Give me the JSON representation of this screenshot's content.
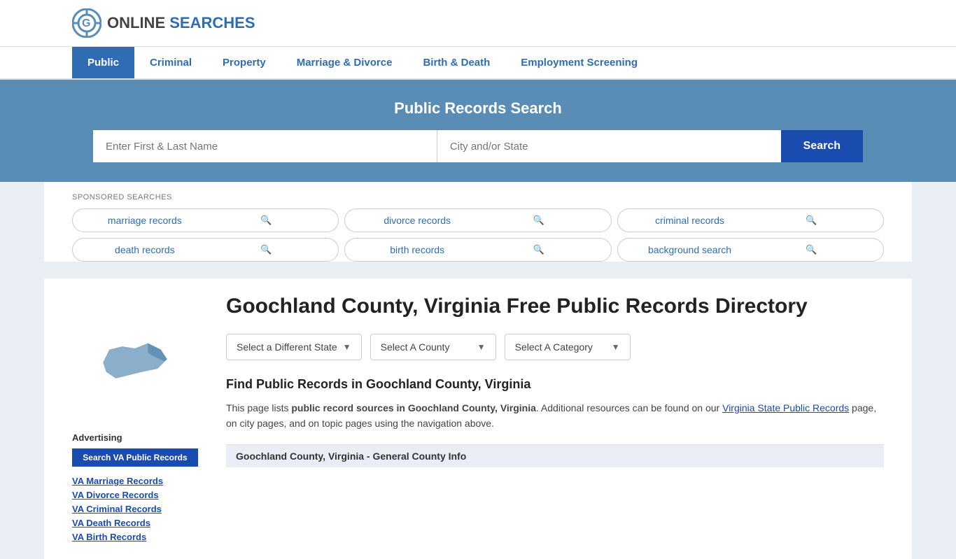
{
  "header": {
    "logo_text_online": "ONLINE",
    "logo_text_searches": "SEARCHES"
  },
  "nav": {
    "items": [
      {
        "label": "Public",
        "active": true
      },
      {
        "label": "Criminal",
        "active": false
      },
      {
        "label": "Property",
        "active": false
      },
      {
        "label": "Marriage & Divorce",
        "active": false
      },
      {
        "label": "Birth & Death",
        "active": false
      },
      {
        "label": "Employment Screening",
        "active": false
      }
    ]
  },
  "search_banner": {
    "title": "Public Records Search",
    "name_placeholder": "Enter First & Last Name",
    "location_placeholder": "City and/or State",
    "button_label": "Search"
  },
  "sponsored": {
    "label": "SPONSORED SEARCHES",
    "pills": [
      {
        "label": "marriage records"
      },
      {
        "label": "divorce records"
      },
      {
        "label": "criminal records"
      },
      {
        "label": "death records"
      },
      {
        "label": "birth records"
      },
      {
        "label": "background search"
      }
    ]
  },
  "county": {
    "title": "Goochland County, Virginia Free Public Records Directory"
  },
  "dropdowns": {
    "state_label": "Select a Different State",
    "county_label": "Select A County",
    "category_label": "Select A Category"
  },
  "find_records": {
    "heading": "Find Public Records in Goochland County, Virginia",
    "text_before_bold": "This page lists ",
    "bold_text": "public record sources in Goochland County, Virginia",
    "text_after": ". Additional resources can be found on our ",
    "link_text": "Virginia State Public Records",
    "text_end": " page, on city pages, and on topic pages using the navigation above."
  },
  "section_heading": "Goochland County, Virginia - General County Info",
  "sidebar": {
    "advertising_label": "Advertising",
    "ad_button_label": "Search VA Public Records",
    "links": [
      {
        "label": "VA Marriage Records"
      },
      {
        "label": "VA Divorce Records"
      },
      {
        "label": "VA Criminal Records"
      },
      {
        "label": "VA Death Records"
      },
      {
        "label": "VA Birth Records"
      }
    ]
  }
}
